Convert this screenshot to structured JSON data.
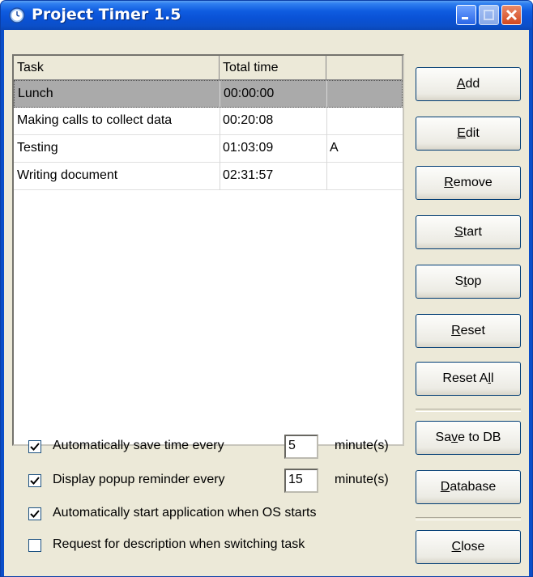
{
  "window": {
    "title": "Project Timer 1.5",
    "icon": "clock-icon",
    "controls": [
      "minimize-icon",
      "maximize-icon",
      "close-icon"
    ]
  },
  "list": {
    "columns": [
      "Task",
      "Total time",
      ""
    ],
    "rows": [
      {
        "task": "Lunch",
        "time": "00:00:00",
        "flag": "",
        "selected": true
      },
      {
        "task": "Making calls to collect data",
        "time": "00:20:08",
        "flag": ""
      },
      {
        "task": "Testing",
        "time": "01:03:09",
        "flag": "A"
      },
      {
        "task": "Writing document",
        "time": "02:31:57",
        "flag": ""
      }
    ]
  },
  "buttons": {
    "add": {
      "pre": "",
      "key": "A",
      "post": "dd"
    },
    "edit": {
      "pre": "",
      "key": "E",
      "post": "dit"
    },
    "remove": {
      "pre": "",
      "key": "R",
      "post": "emove"
    },
    "start": {
      "pre": "",
      "key": "S",
      "post": "tart"
    },
    "stop": {
      "pre": "S",
      "key": "t",
      "post": "op"
    },
    "reset": {
      "pre": "",
      "key": "R",
      "post": "eset"
    },
    "reset_all": {
      "pre": "Reset A",
      "key": "l",
      "post": "l"
    },
    "save_db": {
      "pre": "Sa",
      "key": "v",
      "post": "e to DB"
    },
    "database": {
      "pre": "",
      "key": "D",
      "post": "atabase"
    },
    "close": {
      "pre": "",
      "key": "C",
      "post": "lose"
    }
  },
  "options": {
    "autosave": {
      "checked": true,
      "label": "Automatically save time every",
      "value": "5",
      "unit": "minute(s)"
    },
    "popup": {
      "checked": true,
      "label": "Display popup reminder every",
      "value": "15",
      "unit": "minute(s)"
    },
    "autostart": {
      "checked": true,
      "label": "Automatically start application when OS starts"
    },
    "describe": {
      "checked": false,
      "label": "Request for description when switching task"
    }
  },
  "colors": {
    "titlebar": "#0a52d6",
    "face": "#ece9d8",
    "selection": "#aaaaaa",
    "close_button": "#d3481e"
  }
}
